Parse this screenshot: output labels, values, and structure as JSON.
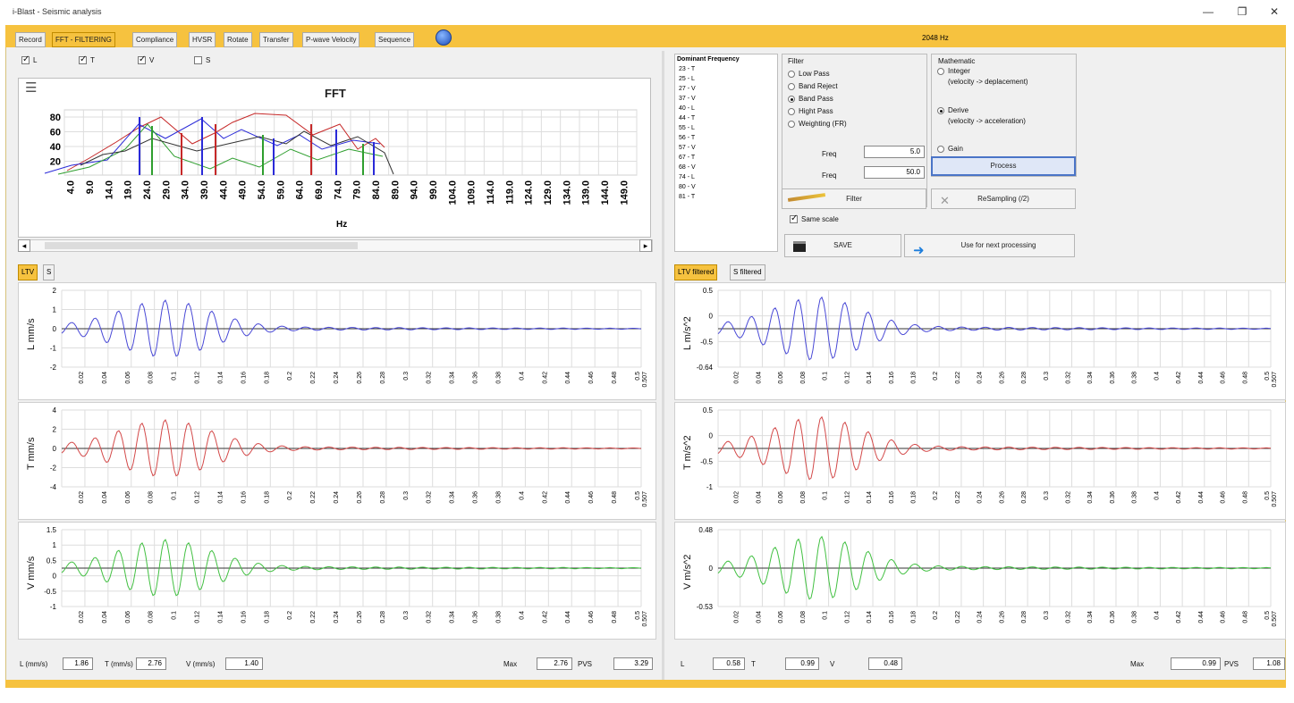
{
  "window": {
    "title": "i-Blast - Seismic analysis",
    "minimize": "—",
    "maximize": "❐",
    "close": "✕",
    "sample_rate": "2048 Hz"
  },
  "tabs": [
    {
      "label": "Record",
      "active": false
    },
    {
      "label": "FFT - FILTERING",
      "active": true
    },
    {
      "label": "Compliance",
      "active": false
    },
    {
      "label": "HVSR",
      "active": false
    },
    {
      "label": "Rotate",
      "active": false
    },
    {
      "label": "Transfer",
      "active": false
    },
    {
      "label": "P-wave Velocity",
      "active": false
    },
    {
      "label": "Sequence",
      "active": false
    }
  ],
  "checks": [
    {
      "label": "L",
      "checked": true
    },
    {
      "label": "T",
      "checked": true
    },
    {
      "label": "V",
      "checked": true
    },
    {
      "label": "S",
      "checked": false
    }
  ],
  "fft": {
    "title": "FFT",
    "xlabel": "Hz",
    "ylabel": "",
    "y_ticks": [
      "80",
      "60",
      "40",
      "20"
    ],
    "x_ticks": [
      "4.0",
      "9.0",
      "14.0",
      "19.0",
      "24.0",
      "29.0",
      "34.0",
      "39.0",
      "44.0",
      "49.0",
      "54.0",
      "59.0",
      "64.0",
      "69.0",
      "74.0",
      "79.0",
      "84.0",
      "89.0",
      "94.0",
      "99.0",
      "104.0",
      "109.0",
      "114.0",
      "119.0",
      "124.0",
      "129.0",
      "134.0",
      "139.0",
      "144.0",
      "149.0"
    ]
  },
  "left_tabs": [
    {
      "label": "LTV",
      "active": true
    },
    {
      "label": "S",
      "active": false
    }
  ],
  "right_tabs": [
    {
      "label": "LTV filtered",
      "active": true
    },
    {
      "label": "S filtered",
      "active": false
    }
  ],
  "time_ticks": [
    "0.02",
    "0.04",
    "0.06",
    "0.08",
    "0.1",
    "0.12",
    "0.14",
    "0.16",
    "0.18",
    "0.2",
    "0.22",
    "0.24",
    "0.26",
    "0.28",
    "0.3",
    "0.32",
    "0.34",
    "0.36",
    "0.38",
    "0.4",
    "0.42",
    "0.44",
    "0.46",
    "0.48",
    "0.5"
  ],
  "time_end": "0.507",
  "left_graphs": [
    {
      "ylabel": "L mm/s",
      "y_ticks": [
        "2",
        "1",
        "0",
        "-1",
        "-2"
      ],
      "color": "#4949d6"
    },
    {
      "ylabel": "T mm/s",
      "y_ticks": [
        "4",
        "2",
        "0",
        "-2",
        "-4"
      ],
      "color": "#d34949"
    },
    {
      "ylabel": "V mm/s",
      "y_ticks": [
        "1.5",
        "1",
        "0.5",
        "0",
        "-0.5",
        "-1"
      ],
      "color": "#42c042"
    }
  ],
  "right_graphs": [
    {
      "ylabel": "L m/s^2",
      "y_ticks": [
        "0.5",
        "0",
        "-0.5",
        "-0.64"
      ],
      "color": "#4949d6"
    },
    {
      "ylabel": "T m/s^2",
      "y_ticks": [
        "0.5",
        "0",
        "-0.5",
        "-1"
      ],
      "color": "#d34949"
    },
    {
      "ylabel": "V m/s^2",
      "y_ticks": [
        "0.48",
        "0",
        "-0.53"
      ],
      "color": "#42c042"
    }
  ],
  "left_status": {
    "l_label": "L (mm/s)",
    "l_value": "1.86",
    "t_label": "T (mm/s)",
    "t_value": "2.76",
    "v_label": "V (mm/s)",
    "v_value": "1.40",
    "max_label": "Max",
    "max_value": "2.76",
    "pvs_label": "PVS",
    "pvs_value": "3.29"
  },
  "right_status": {
    "l_label": "L",
    "l_value": "0.58",
    "t_label": "T",
    "t_value": "0.99",
    "v_label": "V",
    "v_value": "0.48",
    "max_label": "Max",
    "max_value": "0.99",
    "pvs_label": "PVS",
    "pvs_value": "1.08"
  },
  "dominant": {
    "title": "Dominant Frequency",
    "items": [
      "23 - T",
      "25 - L",
      "27 - V",
      "37 - V",
      "40 - L",
      "44 - T",
      "55 - L",
      "56 - T",
      "57 - V",
      "67 - T",
      "68 - V",
      "74 - L",
      "80 - V",
      "81 - T"
    ]
  },
  "filter": {
    "title": "Filter",
    "options": [
      {
        "label": "Low Pass",
        "selected": false
      },
      {
        "label": "Band Reject",
        "selected": false
      },
      {
        "label": "Band Pass",
        "selected": true
      },
      {
        "label": "Hight Pass",
        "selected": false
      },
      {
        "label": "Weighting (FR)",
        "selected": false
      }
    ],
    "freq_label": "Freq",
    "freq1": "5.0",
    "freq2": "50.0",
    "button": "Filter"
  },
  "math": {
    "title": "Mathematic",
    "options": [
      {
        "label": "Integer",
        "sub": "(velocity -> deplacement)",
        "selected": false
      },
      {
        "label": "Derive",
        "sub": "(velocity -> acceleration)",
        "selected": true
      },
      {
        "label": "Gain",
        "sub": "",
        "selected": false
      }
    ],
    "process": "Process",
    "resampling": "ReSampling (/2)"
  },
  "same_scale": {
    "label": "Same scale",
    "checked": true
  },
  "save": "SAVE",
  "next": "Use for next processing"
}
